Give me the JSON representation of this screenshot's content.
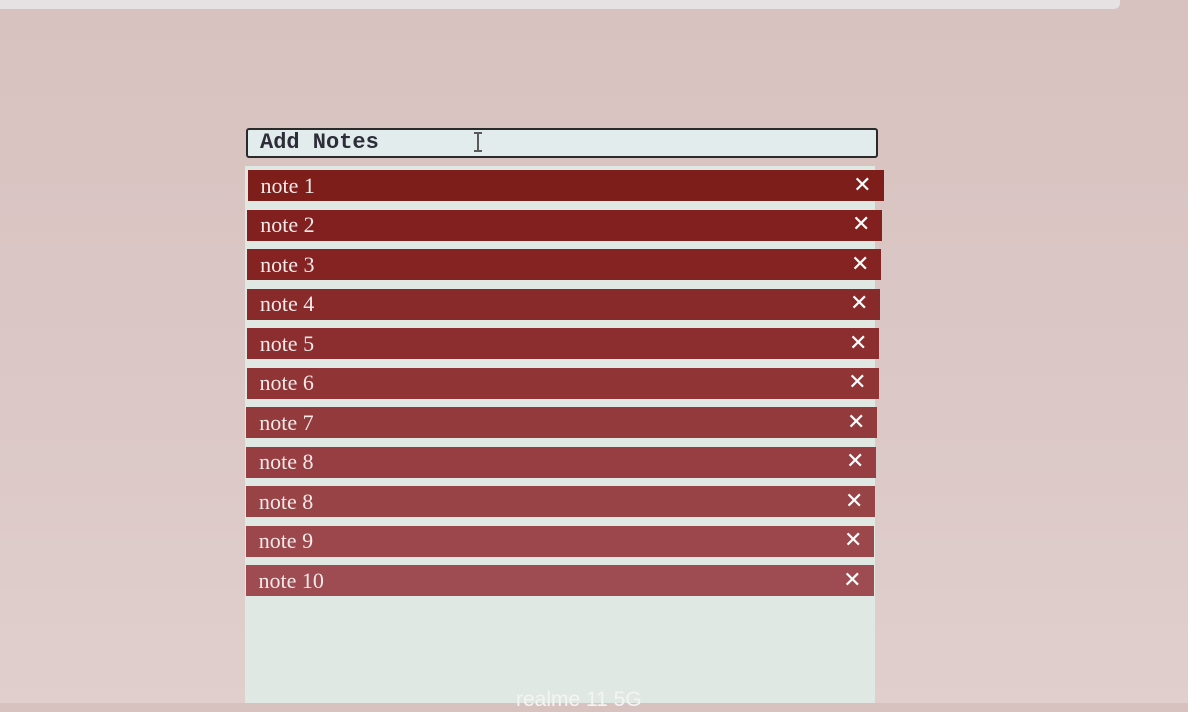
{
  "input": {
    "value": "Add Notes"
  },
  "notes": [
    {
      "label": "note 1",
      "color": "#7d1e1a"
    },
    {
      "label": "note 2",
      "color": "#821f1f"
    },
    {
      "label": "note 3",
      "color": "#852222"
    },
    {
      "label": "note 4",
      "color": "#892a2a"
    },
    {
      "label": "note 5",
      "color": "#8c2e30"
    },
    {
      "label": "note 6",
      "color": "#903436"
    },
    {
      "label": "note 7",
      "color": "#933a3c"
    },
    {
      "label": "note 8",
      "color": "#963e42"
    },
    {
      "label": "note 8",
      "color": "#984346"
    },
    {
      "label": "note 9",
      "color": "#9b474c"
    },
    {
      "label": "note 10",
      "color": "#9e4c52"
    }
  ],
  "close_glyph": "✕",
  "watermark": "realme 11 5G"
}
